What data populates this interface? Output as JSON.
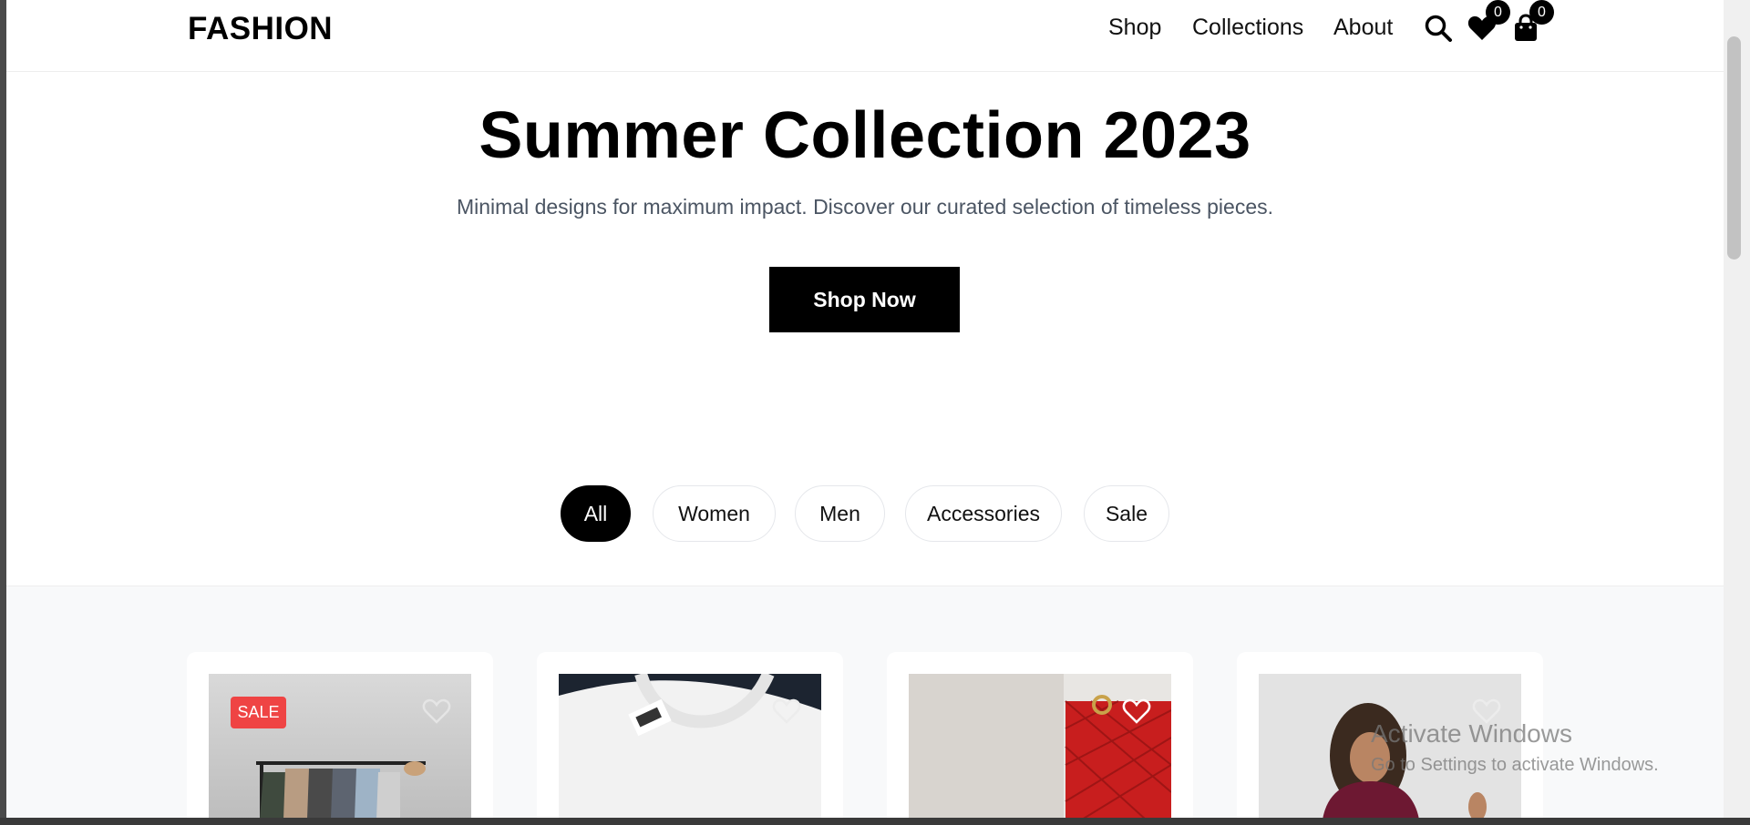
{
  "header": {
    "logo": "FASHION",
    "nav": [
      "Shop",
      "Collections",
      "About"
    ],
    "icons": [
      "search-icon",
      "heart-icon",
      "shopping-bag-icon"
    ],
    "wishlist_count": "0",
    "cart_count": "0"
  },
  "hero": {
    "title": "Summer Collection 2023",
    "subtitle": "Minimal designs for maximum impact. Discover our curated selection of timeless pieces.",
    "cta": "Shop Now"
  },
  "filters": {
    "items": [
      "All",
      "Women",
      "Men",
      "Accessories",
      "Sale"
    ],
    "active": "All"
  },
  "products": {
    "cards": [
      {
        "image": "clothing-rack-photo",
        "badge": "SALE",
        "wishlist_icon": "heart-outline-icon"
      },
      {
        "image": "white-tshirt-collar-photo",
        "wishlist_icon": "heart-outline-icon"
      },
      {
        "image": "red-quilted-handbag-photo",
        "wishlist_icon": "heart-outline-icon"
      },
      {
        "image": "woman-curly-hair-photo",
        "wishlist_icon": "heart-outline-icon"
      }
    ]
  },
  "watermark": {
    "title": "Activate Windows",
    "subtitle": "Go to Settings to activate Windows."
  },
  "colors": {
    "accent": "#000000",
    "sale": "#ef4444",
    "muted_text": "#4b5563",
    "section_bg": "#f8f9fa"
  }
}
